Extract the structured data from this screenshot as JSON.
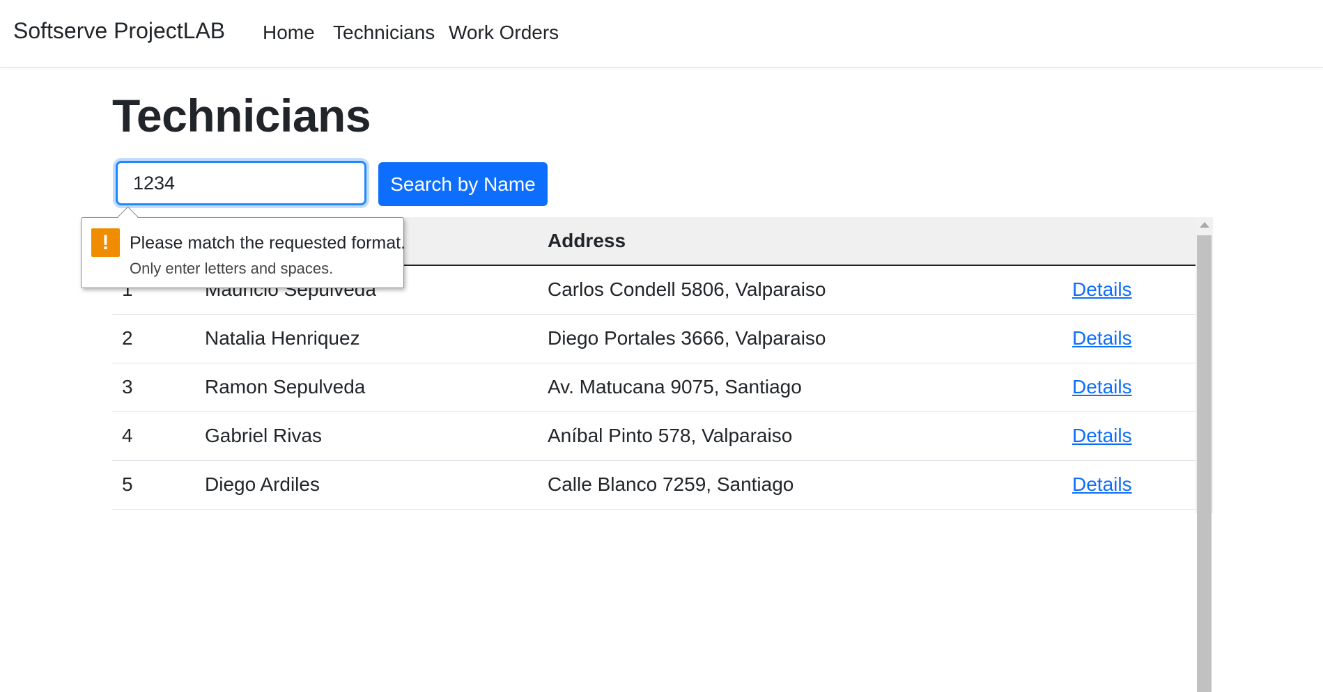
{
  "navbar": {
    "brand": "Softserve ProjectLAB",
    "links": [
      "Home",
      "Technicians",
      "Work Orders"
    ]
  },
  "page": {
    "title": "Technicians"
  },
  "search": {
    "value": "1234",
    "button_label": "Search by Name"
  },
  "validation": {
    "message": "Please match the requested format.",
    "hint": "Only enter letters and spaces.",
    "icon": "warning-icon",
    "icon_glyph": "!",
    "icon_color": "#f08c00"
  },
  "table": {
    "columns": [
      "",
      "",
      "Address",
      ""
    ],
    "rows": [
      {
        "id": "1",
        "name": "Mauricio Sepulveda",
        "address": "Carlos Condell 5806, Valparaiso",
        "action": "Details"
      },
      {
        "id": "2",
        "name": "Natalia Henriquez",
        "address": "Diego Portales 3666, Valparaiso",
        "action": "Details"
      },
      {
        "id": "3",
        "name": "Ramon Sepulveda",
        "address": "Av. Matucana 9075, Santiago",
        "action": "Details"
      },
      {
        "id": "4",
        "name": "Gabriel Rivas",
        "address": "Aníbal Pinto 578, Valparaiso",
        "action": "Details"
      },
      {
        "id": "5",
        "name": "Diego Ardiles",
        "address": "Calle Blanco 7259, Santiago",
        "action": "Details"
      }
    ]
  },
  "colors": {
    "primary": "#0d6efd",
    "warning": "#f08c00"
  }
}
